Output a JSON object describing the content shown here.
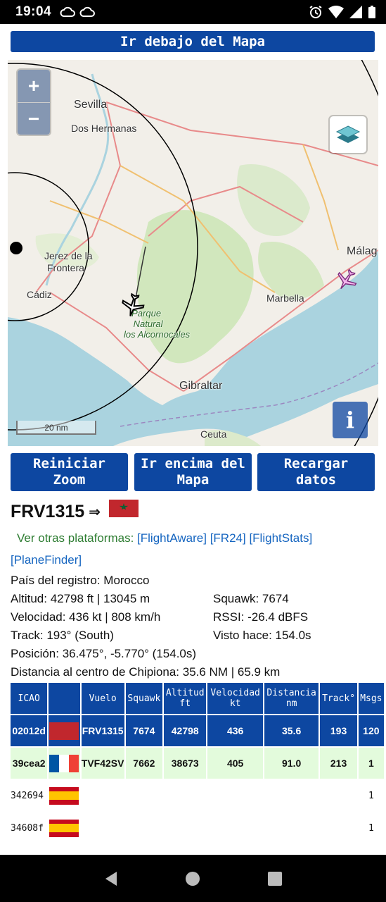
{
  "status": {
    "time": "19:04",
    "icons": [
      "cloud-icon",
      "cloud-icon",
      "alarm-icon",
      "wifi-icon",
      "signal-icon",
      "battery-icon"
    ]
  },
  "top_button": "Ir debajo del Mapa",
  "map": {
    "zoom_in": "+",
    "zoom_out": "−",
    "scale": "20 nm",
    "info": "i",
    "labels": {
      "sevilla": "Sevilla",
      "dos_hermanas": "Dos Hermanas",
      "jerez": "Jerez de la",
      "jerez2": "Frontera",
      "cadiz": "Cádiz",
      "parque1": "Parque",
      "parque2": "Natural",
      "parque3": "los Alcornocales",
      "gibraltar": "Gibraltar",
      "marbella": "Marbella",
      "malaga": "Málag",
      "ceuta": "Ceuta"
    }
  },
  "buttons": {
    "reset_zoom": [
      "Reiniciar",
      "Zoom"
    ],
    "above_map": [
      "Ir encima del",
      "Mapa"
    ],
    "reload": [
      "Recargar",
      "datos"
    ]
  },
  "flight": {
    "callsign": "FRV1315",
    "arrow": "⇒",
    "other_platforms_label": "Ver otras plataformas:",
    "links": [
      "[FlightAware]",
      "[FR24]",
      "[FlightStats]",
      "[PlaneFinder]"
    ],
    "country": "País del registro: Morocco",
    "altitude": "Altitud: 42798 ft | 13045 m",
    "speed": "Velocidad: 436 kt | 808 km/h",
    "track": "Track: 193° (South)",
    "position": "Posición: 36.475°, -5.770° (154.0s)",
    "distance": "Distancia al centro de Chipiona: 35.6 NM | 65.9 km",
    "squawk": "Squawk: 7674",
    "rssi": "RSSI: -26.4 dBFS",
    "seen": "Visto hace: 154.0s"
  },
  "table": {
    "headers": [
      "ICAO",
      "",
      "Vuelo",
      "Squawk",
      "Altitud\nft",
      "Velocidad\nkt",
      "Distancia\nnm",
      "Track°",
      "Msgs"
    ],
    "rows": [
      {
        "icao": "02012d",
        "flag": "Morocco",
        "flight": "FRV1315",
        "squawk": "7674",
        "alt": "42798",
        "speed": "436",
        "dist": "35.6",
        "track": "193",
        "msgs": "120"
      },
      {
        "icao": "39cea2",
        "flag": "France",
        "flight": "TVF42SV",
        "squawk": "7662",
        "alt": "38673",
        "speed": "405",
        "dist": "91.0",
        "track": "213",
        "msgs": "1"
      },
      {
        "icao": "342694",
        "flag": "Spain",
        "flight": "",
        "squawk": "",
        "alt": "",
        "speed": "",
        "dist": "",
        "track": "",
        "msgs": "1"
      },
      {
        "icao": "34608f",
        "flag": "Spain",
        "flight": "",
        "squawk": "",
        "alt": "",
        "speed": "",
        "dist": "",
        "track": "",
        "msgs": "1"
      }
    ]
  },
  "navbar": [
    "back-icon",
    "home-icon",
    "recents-icon"
  ]
}
